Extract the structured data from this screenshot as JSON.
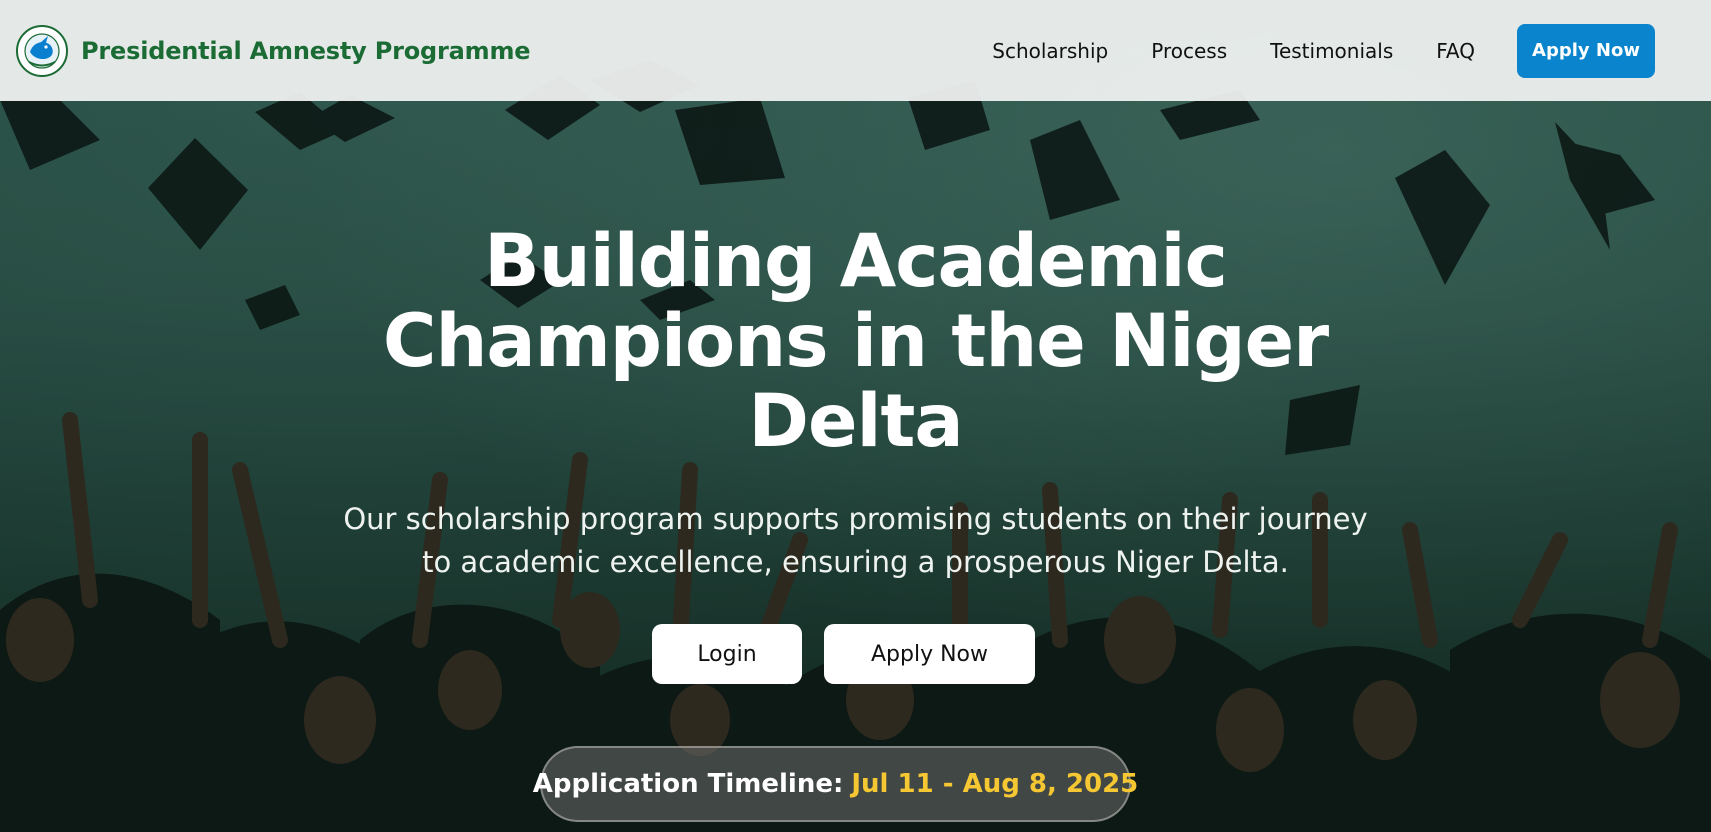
{
  "header": {
    "brand": "Presidential Amnesty Programme",
    "nav": [
      "Scholarship",
      "Process",
      "Testimonials",
      "FAQ"
    ],
    "apply_label": "Apply Now"
  },
  "hero": {
    "headline_lines": [
      "Building Academic",
      "Champions in the Niger",
      "Delta"
    ],
    "subtitle_lines": [
      "Our scholarship program supports promising students on their journey",
      "to academic excellence, ensuring a prosperous Niger Delta."
    ],
    "login_label": "Login",
    "apply_label": "Apply Now",
    "timeline_label": "Application Timeline:",
    "timeline_dates": "Jul 11 - Aug 8, 2025"
  },
  "colors": {
    "brand_green": "#1b6b35",
    "primary_blue": "#0a84cc",
    "accent_yellow": "#f5c732"
  },
  "icons": {
    "logo": "presidential-amnesty-seal"
  }
}
